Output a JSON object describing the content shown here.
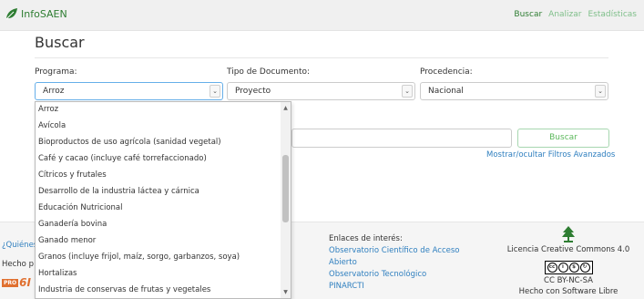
{
  "navbar": {
    "brand": "InfoSAEN",
    "links": [
      "Buscar",
      "Analizar",
      "Estadísticas"
    ],
    "active": "Buscar"
  },
  "page": {
    "title": "Buscar"
  },
  "filters": {
    "programa": {
      "label": "Programa:",
      "value": "Arroz"
    },
    "tipo": {
      "label": "Tipo de Documento:",
      "value": "Proyecto"
    },
    "procedencia": {
      "label": "Procedencia:",
      "value": "Nacional"
    }
  },
  "search": {
    "button_label": "Buscar",
    "toggle_label": "Mostrar/ocultar Filtros Avanzados"
  },
  "dropdown_options": [
    "Arroz",
    "Avícola",
    "Bioproductos de uso agrícola (sanidad vegetal)",
    "Café y cacao (incluye café torrefaccionado)",
    "Cítricos y frutales",
    "Desarrollo de la industria láctea y cárnica",
    "Educación Nutricional",
    "Ganadería bovina",
    "Ganado menor",
    "Granos (incluye frijol, maíz, sorgo, garbanzos, soya)",
    "Hortalizas",
    "Industria de conservas de frutas y vegetales"
  ],
  "footer": {
    "left_link": "¿Quiénes",
    "left_text": "Hecho p",
    "left_logo": "6I",
    "left_badge": "PRO",
    "links_title": "Enlaces de interés:",
    "links": [
      "Observatorio Científico de Acceso",
      "Abierto",
      "Observatorio Tecnológico",
      "PINARCTI"
    ],
    "license": "Licencia Creative Commons 4.0",
    "license_short": "CC BY-NC-SA",
    "software": "Hecho con Software Libre"
  },
  "colors": {
    "brand": "#2e7d32",
    "link": "#2f7fbf",
    "button": "#5cb85c"
  }
}
